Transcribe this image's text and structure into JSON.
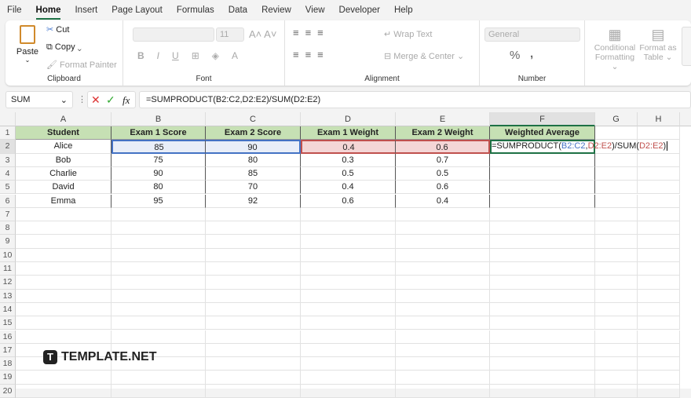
{
  "menu": [
    "File",
    "Home",
    "Insert",
    "Page Layout",
    "Formulas",
    "Data",
    "Review",
    "View",
    "Developer",
    "Help"
  ],
  "active_menu": "Home",
  "ribbon": {
    "clipboard": {
      "paste": "Paste",
      "cut": "Cut",
      "copy": "Copy",
      "format_painter": "Format Painter",
      "label": "Clipboard"
    },
    "font": {
      "size": "11",
      "bold": "B",
      "italic": "I",
      "underline": "U",
      "label": "Font"
    },
    "alignment": {
      "wrap_text": "Wrap Text",
      "merge_center": "Merge & Center",
      "label": "Alignment"
    },
    "number": {
      "format": "General",
      "percent": "%",
      "comma": ",",
      "label": "Number"
    },
    "styles": {
      "conditional": "Conditional",
      "formatting": "Formatting",
      "format_as": "Format as",
      "table": "Table"
    }
  },
  "formula_bar": {
    "name_box": "SUM",
    "fx": "fx",
    "formula": "=SUMPRODUCT(B2:C2,D2:E2)/SUM(D2:E2)"
  },
  "sheet": {
    "columns": [
      "A",
      "B",
      "C",
      "D",
      "E",
      "F",
      "G",
      "H"
    ],
    "headers": [
      "Student",
      "Exam 1 Score",
      "Exam 2 Score",
      "Exam 1 Weight",
      "Exam 2 Weight",
      "Weighted Average"
    ],
    "rows": [
      [
        "Alice",
        "85",
        "90",
        "0.4",
        "0.6"
      ],
      [
        "Bob",
        "75",
        "80",
        "0.3",
        "0.7"
      ],
      [
        "Charlie",
        "90",
        "85",
        "0.5",
        "0.5"
      ],
      [
        "David",
        "80",
        "70",
        "0.4",
        "0.6"
      ],
      [
        "Emma",
        "95",
        "92",
        "0.6",
        "0.4"
      ]
    ],
    "edit_formula": {
      "a": "=SUMPRODUCT(",
      "b": "B2:C2",
      ",": ",",
      "d": "D2:E2",
      "c": ")/SUM(",
      "e": "D2:E2",
      ")": ")"
    }
  },
  "watermark": "TEMPLATE.NET",
  "colors": {
    "accent": "#1e7145",
    "header_fill": "#c6e0b4",
    "ref_blue": "#4472c4",
    "ref_red": "#c0504d"
  }
}
